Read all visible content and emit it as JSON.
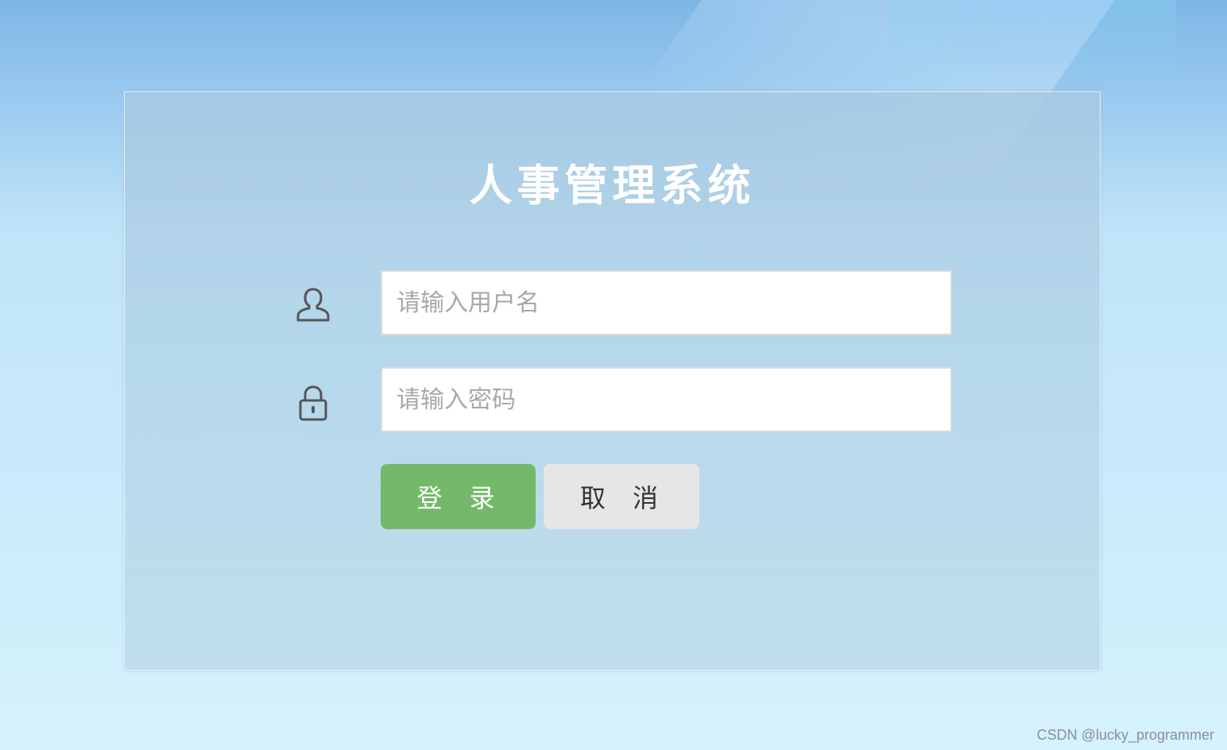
{
  "login": {
    "title": "人事管理系统",
    "username_placeholder": "请输入用户名",
    "password_placeholder": "请输入密码",
    "login_label": "登录",
    "cancel_label": "取消"
  },
  "icons": {
    "username": "user-icon",
    "password": "lock-icon"
  },
  "colors": {
    "login_button": "#74b96a",
    "cancel_button": "#e6e6e6",
    "title_text": "#ffffff"
  },
  "watermark": "CSDN @lucky_programmer"
}
